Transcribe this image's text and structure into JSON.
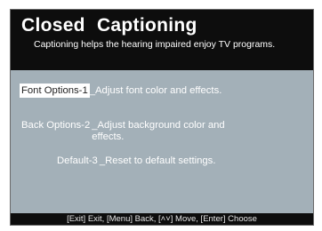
{
  "header": {
    "title": "Closed  Captioning",
    "subtitle": "Captioning helps the hearing impaired enjoy TV programs."
  },
  "options": [
    {
      "key": "Font Options-1",
      "desc": "_Adjust font color and effects.",
      "selected": true
    },
    {
      "key": "Back Options-2",
      "desc": "_Adjust background color and effects.",
      "selected": false
    },
    {
      "key": "Default-3",
      "desc": "_Reset to default settings.",
      "selected": false
    }
  ],
  "footer": {
    "hint": "[Exit] Exit, [Menu] Back, [˄˅] Move, [Enter] Choose"
  }
}
